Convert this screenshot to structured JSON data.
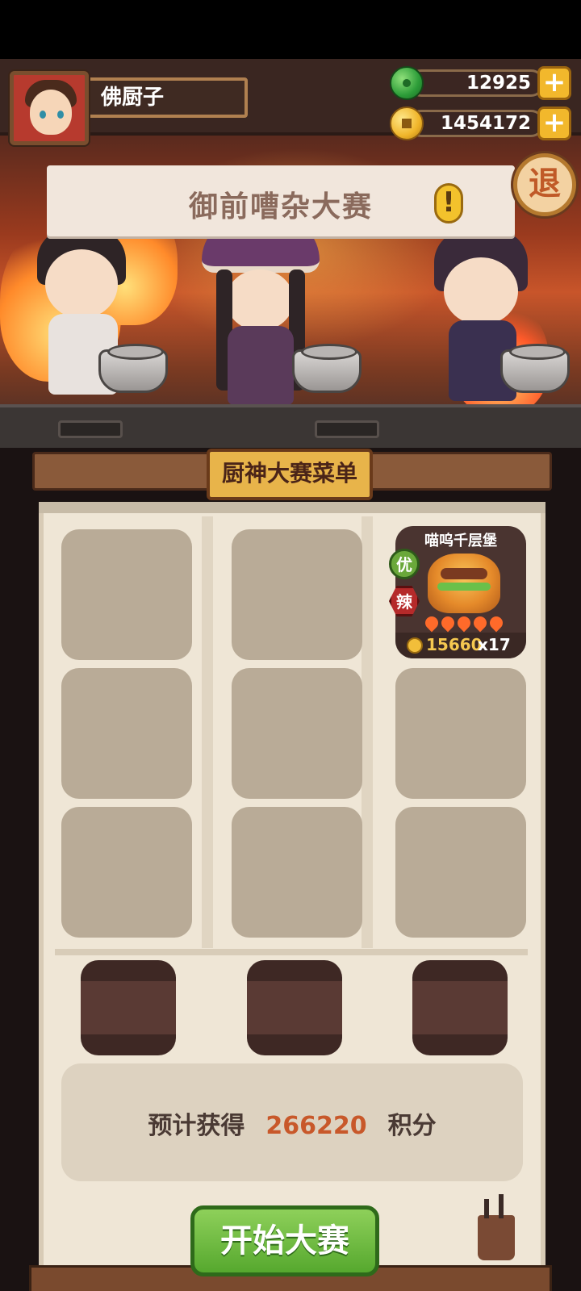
{
  "player": {
    "name": "佛厨子"
  },
  "currencies": {
    "jade": {
      "amount": "12925",
      "icon": "jade-icon"
    },
    "gold": {
      "amount": "1454172",
      "icon": "coin-icon"
    }
  },
  "exit_label": "退",
  "event_title": "御前嘈杂大赛",
  "menu_title": "厨神大赛菜单",
  "dish": {
    "name": "喵呜千层堡",
    "badges": [
      "优",
      "辣"
    ],
    "spice_level": 5,
    "gold": "15660",
    "count": "x17"
  },
  "score": {
    "prefix": "预计获得",
    "value": "266220",
    "suffix": "积分"
  },
  "start_button": "开始大赛",
  "colors": {
    "accent_gold": "#e8b44a",
    "score_value": "#c8582a",
    "start_green": "#56a82e"
  }
}
